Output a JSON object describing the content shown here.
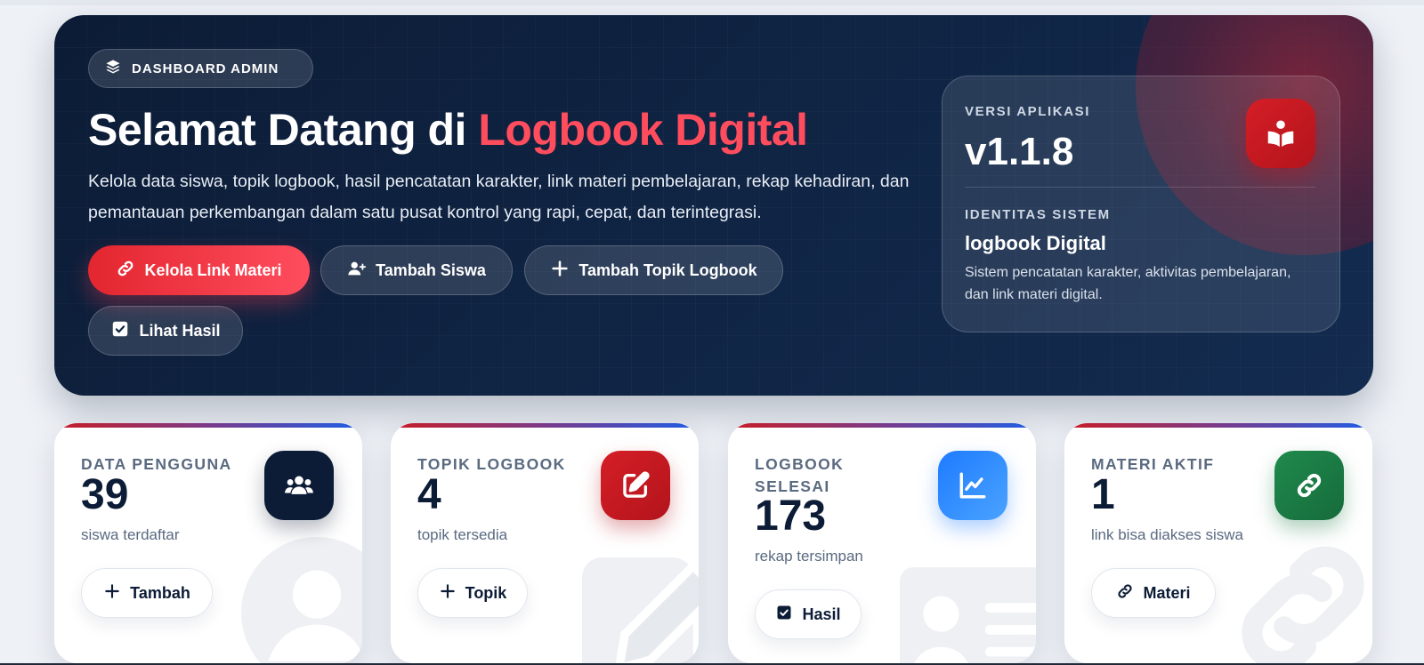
{
  "hero": {
    "badge": "DASHBOARD ADMIN",
    "title_prefix": "Selamat Datang di ",
    "title_accent": "Logbook Digital",
    "description": "Kelola data siswa, topik logbook, hasil pencatatan karakter, link materi pembelajaran, rekap kehadiran, dan pemantauan perkembangan dalam satu pusat kontrol yang rapi, cepat, dan terintegrasi.",
    "buttons": [
      {
        "label": "Kelola Link Materi",
        "icon": "link-icon"
      },
      {
        "label": "Tambah Siswa",
        "icon": "user-plus-icon"
      },
      {
        "label": "Tambah Topik Logbook",
        "icon": "plus-icon"
      },
      {
        "label": "Lihat Hasil",
        "icon": "check-square-icon"
      }
    ]
  },
  "version_card": {
    "version_label": "VERSI APLIKASI",
    "version": "v1.1.8",
    "identity_label": "IDENTITAS SISTEM",
    "system_name": "logbook Digital",
    "system_desc": "Sistem pencatatan karakter, aktivitas pembelajaran, dan link materi digital.",
    "icon": "book-reader-icon"
  },
  "stats": [
    {
      "label": "DATA PENGGUNA",
      "value": "39",
      "sub": "siswa terdaftar",
      "button": "Tambah",
      "icon": "users-icon",
      "color": "#0c1c36"
    },
    {
      "label": "TOPIK LOGBOOK",
      "value": "4",
      "sub": "topik tersedia",
      "button": "Topik",
      "icon": "edit-icon",
      "color": "#c81d25"
    },
    {
      "label": "LOGBOOK SELESAI",
      "value": "173",
      "sub": "rekap tersimpan",
      "button": "Hasil",
      "icon": "chart-line-icon",
      "color": "#2f8cff"
    },
    {
      "label": "MATERI AKTIF",
      "value": "1",
      "sub": "link bisa diakses siswa",
      "button": "Materi",
      "icon": "link-icon",
      "color": "#1a7a45"
    }
  ]
}
